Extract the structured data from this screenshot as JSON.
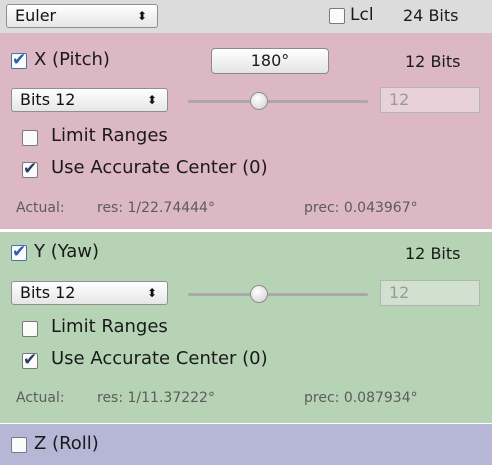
{
  "header": {
    "rotation_mode": "Euler",
    "lcl_label": "Lcl",
    "lcl_checked": false,
    "bits_total": "24 Bits"
  },
  "x_axis": {
    "enabled": true,
    "label": "X (Pitch)",
    "button_label": "180°",
    "bits_right": "12 Bits",
    "bits_select": "Bits 12",
    "slider_value": 12,
    "field_value": "12",
    "limit_ranges_label": "Limit Ranges",
    "limit_ranges_checked": false,
    "accurate_center_label": "Use Accurate Center (0)",
    "accurate_center_checked": true,
    "actual_label": "Actual:",
    "res": "res: 1/22.74444°",
    "prec": "prec: 0.043967°"
  },
  "y_axis": {
    "enabled": true,
    "label": "Y (Yaw)",
    "bits_right": "12 Bits",
    "bits_select": "Bits 12",
    "slider_value": 12,
    "field_value": "12",
    "limit_ranges_label": "Limit Ranges",
    "limit_ranges_checked": false,
    "accurate_center_label": "Use Accurate Center (0)",
    "accurate_center_checked": true,
    "actual_label": "Actual:",
    "res": "res: 1/11.37222°",
    "prec": "prec: 0.087934°"
  },
  "z_axis": {
    "enabled": false,
    "label": "Z (Roll)"
  },
  "colors": {
    "x_section": "#dcb8c4",
    "y_section": "#b7d3b5",
    "z_section": "#b6b6d6"
  }
}
